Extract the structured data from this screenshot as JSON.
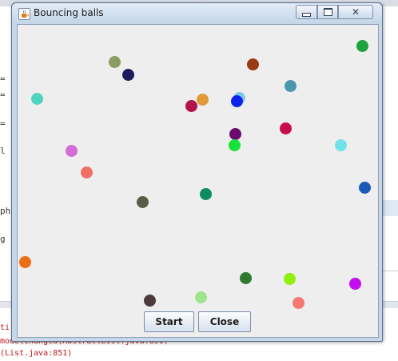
{
  "window": {
    "title": "Bouncing balls",
    "close_glyph": "✕",
    "icon": "java-cup-icon"
  },
  "buttons": {
    "start": "Start",
    "close": "Close"
  },
  "background": {
    "code_fragments": [
      "=",
      "=",
      "=",
      "l",
      "ph",
      "g"
    ],
    "console_lines": [
      "ti",
      "modelChanged(AbstractList.java:851)",
      "(List.java:851)"
    ]
  },
  "balls": [
    {
      "color": "#1fa33c"
    },
    {
      "color": "#8c9c62"
    },
    {
      "color": "#9a3a14"
    },
    {
      "color": "#1c1a5a"
    },
    {
      "color": "#4d97ac"
    },
    {
      "color": "#4fd4bf"
    },
    {
      "color": "#e09a3a"
    },
    {
      "color": "#b3134c"
    },
    {
      "color": "#7fc8e4"
    },
    {
      "color": "#0a24ea"
    },
    {
      "color": "#c80e4a"
    },
    {
      "color": "#6a0a6e"
    },
    {
      "color": "#16e23a"
    },
    {
      "color": "#6ee4ea"
    },
    {
      "color": "#d36cd6"
    },
    {
      "color": "#f07068"
    },
    {
      "color": "#5c5c48"
    },
    {
      "color": "#0d8b63"
    },
    {
      "color": "#1c5ab8"
    },
    {
      "color": "#ec6f16"
    },
    {
      "color": "#2f7a2e"
    },
    {
      "color": "#8ef00c"
    },
    {
      "color": "#c40ef0"
    },
    {
      "color": "#4e3a3c"
    },
    {
      "color": "#9ee48a"
    },
    {
      "color": "#f5796e"
    }
  ]
}
